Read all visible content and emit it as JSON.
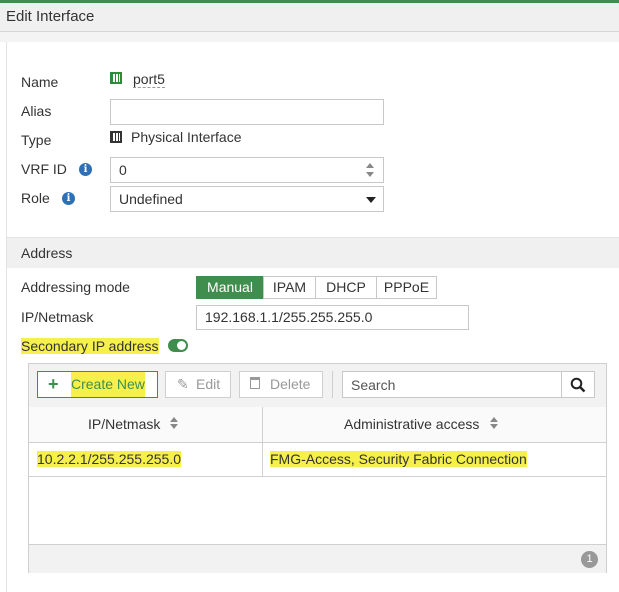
{
  "window": {
    "title": "Edit Interface"
  },
  "form": {
    "name_label": "Name",
    "name_value": "port5",
    "alias_label": "Alias",
    "alias_value": "",
    "type_label": "Type",
    "type_value": "Physical Interface",
    "vrf_label": "VRF ID",
    "vrf_value": "0",
    "role_label": "Role",
    "role_value": "Undefined"
  },
  "address": {
    "section_title": "Address",
    "mode_label": "Addressing mode",
    "modes": [
      "Manual",
      "IPAM",
      "DHCP",
      "PPPoE"
    ],
    "selected_mode": "Manual",
    "ipnetmask_label": "IP/Netmask",
    "ipnetmask_value": "192.168.1.1/255.255.255.0",
    "secondary_label": "Secondary IP address",
    "secondary_enabled": true
  },
  "secondary_table": {
    "toolbar": {
      "create_label": "Create New",
      "edit_label": "Edit",
      "delete_label": "Delete",
      "search_placeholder": "Search"
    },
    "columns": [
      "IP/Netmask",
      "Administrative access"
    ],
    "rows": [
      {
        "ipnetmask": "10.2.2.1/255.255.255.0",
        "access": "FMG-Access, Security Fabric Connection"
      }
    ],
    "count": "1"
  },
  "colors": {
    "accent": "#3f8e4d",
    "info": "#2f6fb5",
    "highlight": "#f6f04a"
  },
  "icons": [
    "port-icon",
    "physical-interface-icon",
    "info-icon",
    "chevron-down-icon",
    "plus-icon",
    "pencil-icon",
    "trash-icon",
    "search-icon",
    "sort-icon"
  ]
}
